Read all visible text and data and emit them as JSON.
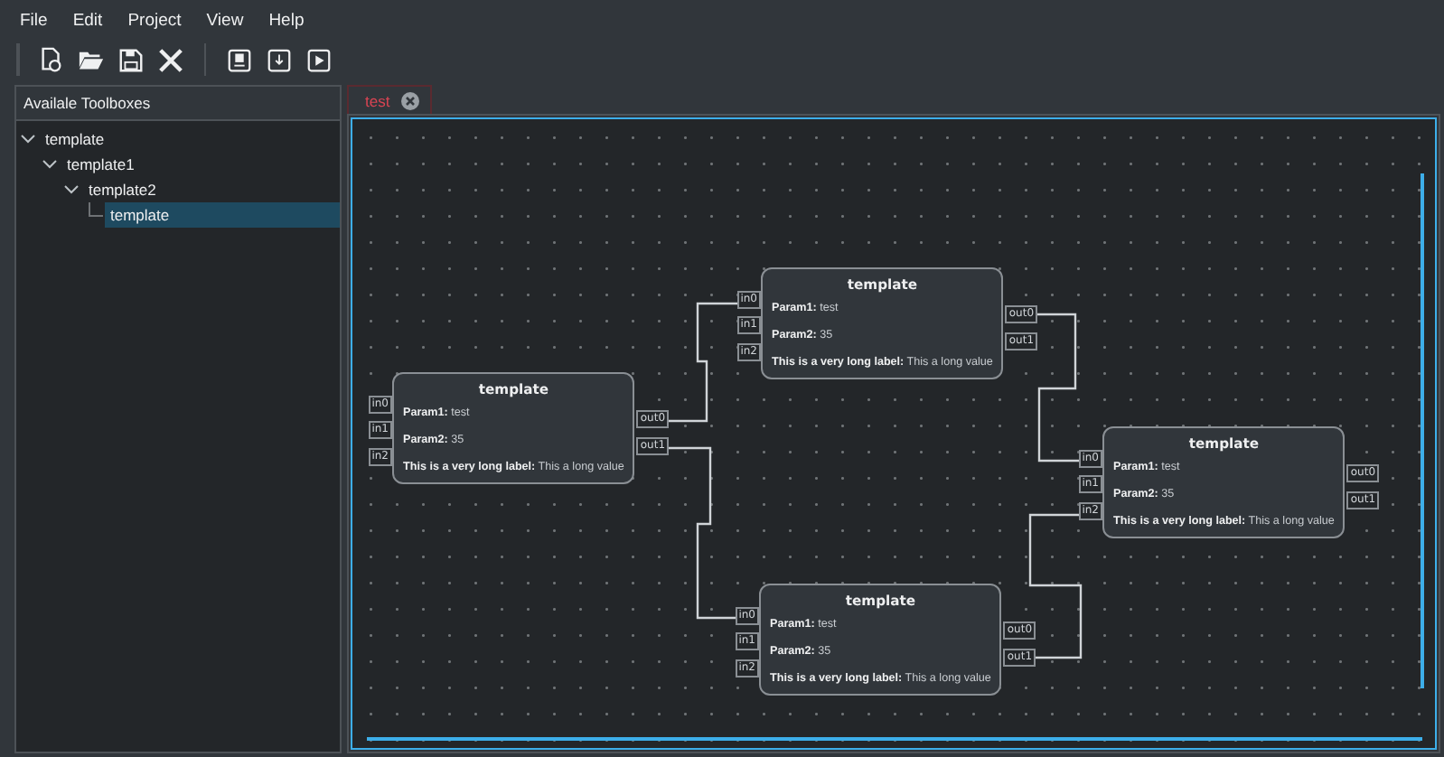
{
  "menu": [
    "File",
    "Edit",
    "Project",
    "View",
    "Help"
  ],
  "toolbar": [
    {
      "kind": "new"
    },
    {
      "kind": "open"
    },
    {
      "kind": "save"
    },
    {
      "kind": "close"
    },
    {
      "kind": "separator"
    },
    {
      "kind": "bulb"
    },
    {
      "kind": "console"
    },
    {
      "kind": "run"
    }
  ],
  "sidebar": {
    "title": "Availale Toolboxes",
    "tree": [
      {
        "label": "template",
        "expanded": true,
        "selected": false,
        "children": [
          {
            "label": "template1",
            "expanded": true,
            "selected": false,
            "children": [
              {
                "label": "template2",
                "expanded": true,
                "selected": false,
                "children": [
                  {
                    "label": "template",
                    "selected": true
                  }
                ]
              }
            ]
          }
        ]
      }
    ]
  },
  "tabs": [
    {
      "label": "test",
      "selected": true
    }
  ],
  "nodes": [
    {
      "title": "template",
      "params": [
        {
          "label": "Param1:",
          "value": "test"
        },
        {
          "label": "Param2:",
          "value": "35"
        },
        {
          "label": "This is a very long label:",
          "value": "This a long value"
        }
      ],
      "inputs": [
        "in0",
        "in1",
        "in2"
      ],
      "outputs": [
        "out0",
        "out1"
      ]
    },
    {
      "title": "template",
      "params": [
        {
          "label": "Param1:",
          "value": "test"
        },
        {
          "label": "Param2:",
          "value": "35"
        },
        {
          "label": "This is a very long label:",
          "value": "This a long value"
        }
      ],
      "inputs": [
        "in0",
        "in1",
        "in2"
      ],
      "outputs": [
        "out0",
        "out1"
      ]
    },
    {
      "title": "template",
      "params": [
        {
          "label": "Param1:",
          "value": "test"
        },
        {
          "label": "Param2:",
          "value": "35"
        },
        {
          "label": "This is a very long label:",
          "value": "This a long value"
        }
      ],
      "inputs": [
        "in0",
        "in1",
        "in2"
      ],
      "outputs": [
        "out0",
        "out1"
      ]
    },
    {
      "title": "template",
      "params": [
        {
          "label": "Param1:",
          "value": "test"
        },
        {
          "label": "Param2:",
          "value": "35"
        },
        {
          "label": "This is a very long label:",
          "value": "This a long value"
        }
      ],
      "inputs": [
        "in0",
        "in1",
        "in2"
      ],
      "outputs": [
        "out0",
        "out1"
      ]
    }
  ]
}
